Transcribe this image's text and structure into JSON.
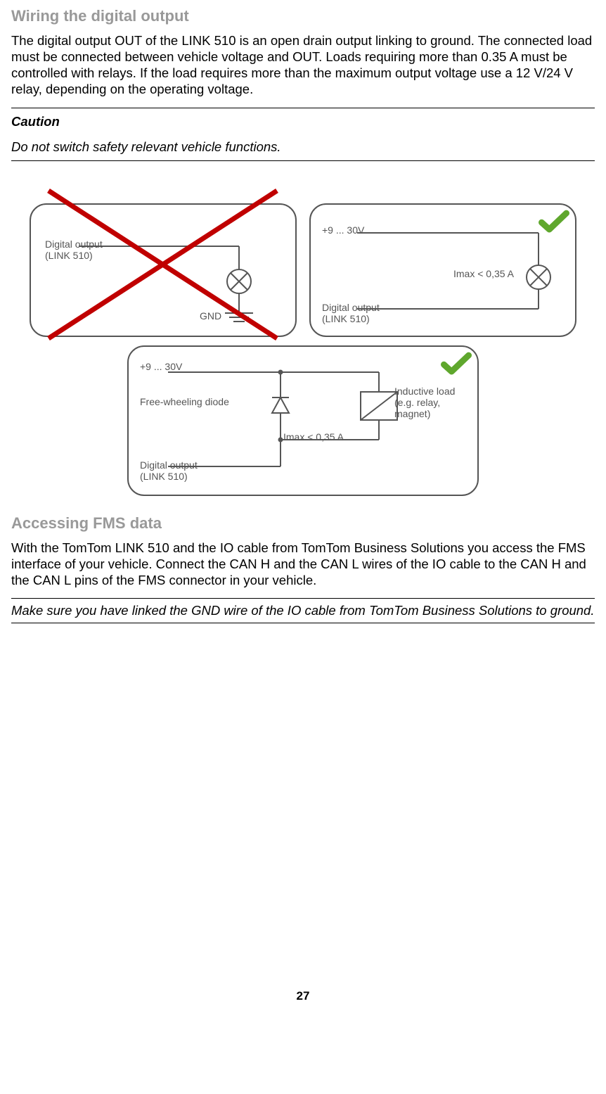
{
  "section1": {
    "heading": "Wiring the digital output",
    "paragraph": "The digital output OUT of the LINK 510 is an open drain output linking to ground. The connected load must be connected between vehicle voltage and OUT. Loads requiring more than 0.35 A must be controlled with relays. If the load requires more than the maximum output voltage use a 12 V/24 V relay, depending on the operating voltage."
  },
  "caution": {
    "title": "Caution",
    "body": "Do not switch safety relevant vehicle functions."
  },
  "diagram1": {
    "out_label_a": "Digital output",
    "out_label_b": "(LINK 510)",
    "gnd_label": "GND"
  },
  "diagram2": {
    "voltage": "+9 ... 30V",
    "imax": "Imax < 0,35 A",
    "out_label_a": "Digital output",
    "out_label_b": "(LINK 510)"
  },
  "diagram3": {
    "voltage": "+9 ... 30V",
    "diode": "Free-wheeling diode",
    "load_a": "Inductive load",
    "load_b": "(e.g. relay, magnet)",
    "imax": "Imax < 0,35 A",
    "out_label_a": "Digital output",
    "out_label_b": "(LINK 510)"
  },
  "section2": {
    "heading": "Accessing FMS data",
    "paragraph": "With the TomTom LINK 510 and the IO cable from TomTom Business Solutions you access the FMS interface of your vehicle. Connect the CAN H and the CAN L wires of the IO cable to the CAN H and the CAN L pins of the FMS connector in your vehicle."
  },
  "note2": {
    "body": "Make sure you have linked the GND wire of the IO cable from TomTom Business Solutions to ground."
  },
  "page_number": "27"
}
